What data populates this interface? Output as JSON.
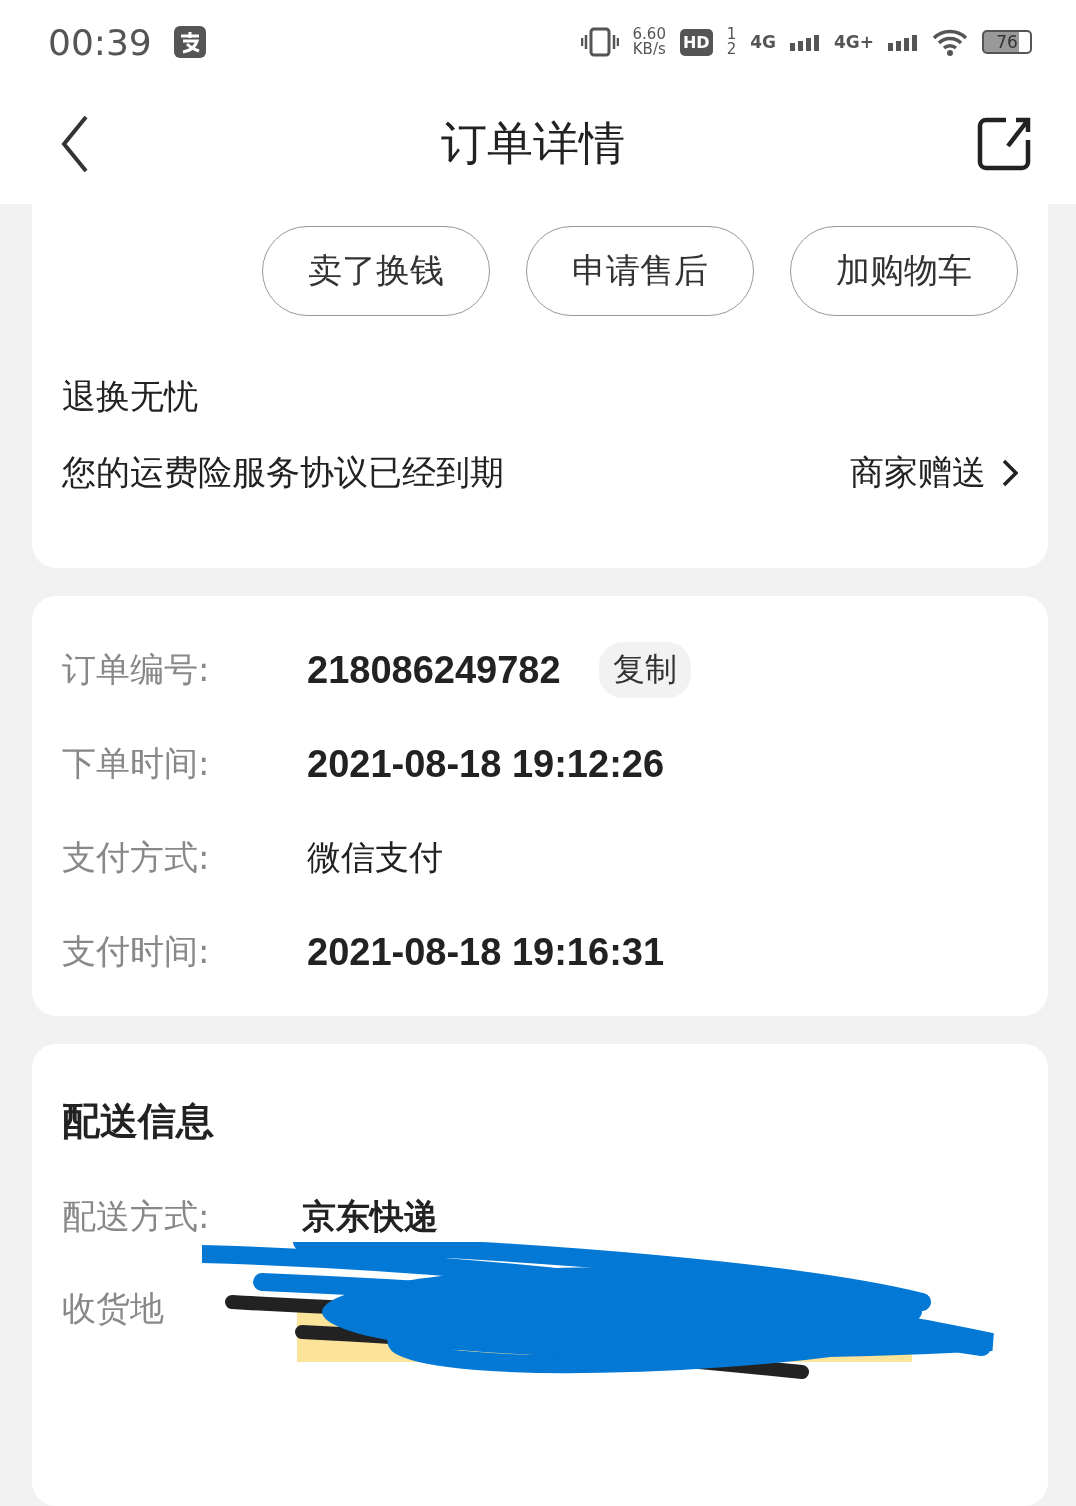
{
  "status_bar": {
    "time": "00:39",
    "net_speed": "6.60",
    "net_unit": "KB/s",
    "hd": "HD",
    "sim_1": "1",
    "sim_2": "2",
    "network_1": "4G",
    "network_2": "4G+",
    "battery": "76"
  },
  "header": {
    "title": "订单详情"
  },
  "actions": [
    "卖了换钱",
    "申请售后",
    "加购物车"
  ],
  "insurance": {
    "title": "退换无忧",
    "message": "您的运费险服务协议已经到期",
    "link": "商家赠送"
  },
  "order_info": [
    {
      "label": "订单编号:",
      "value": "218086249782",
      "bold": true,
      "copy": "复制"
    },
    {
      "label": "下单时间:",
      "value": "2021-08-18 19:12:26",
      "bold": true
    },
    {
      "label": "支付方式:",
      "value": "微信支付",
      "bold": false
    },
    {
      "label": "支付时间:",
      "value": "2021-08-18 19:16:31",
      "bold": true
    }
  ],
  "delivery": {
    "title": "配送信息",
    "rows": [
      {
        "label": "配送方式:",
        "value": "京东快递"
      },
      {
        "label": "收货地",
        "value": ""
      }
    ]
  }
}
